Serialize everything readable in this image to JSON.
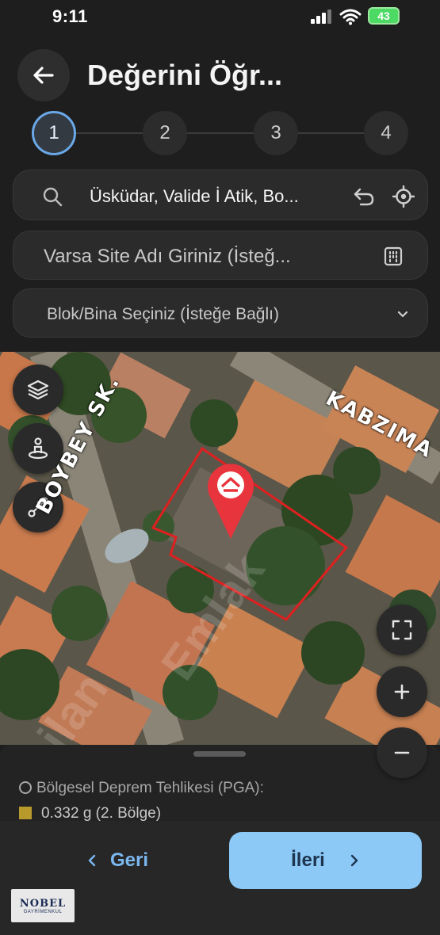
{
  "status_bar": {
    "time": "9:11",
    "battery": "43"
  },
  "header": {
    "title": "Değerini Öğr..."
  },
  "stepper": {
    "steps": [
      "1",
      "2",
      "3",
      "4"
    ],
    "active_step": 1
  },
  "search": {
    "value": "Üsküdar, Valide İ Atik, Bo..."
  },
  "site_name": {
    "placeholder": "Varsa Site Adı Giriniz (İsteğ..."
  },
  "block_select": {
    "placeholder": "Blok/Bina Seçiniz (İsteğe Bağlı)"
  },
  "map": {
    "streets": {
      "boybey": "BOYBEY SK.",
      "kabzima": "KABZIMA"
    },
    "pin_color": "#e8343c",
    "parcel_color": "#e02020"
  },
  "info_sheet": {
    "pga_label": "Bölgesel Deprem Tehlikesi (PGA):",
    "pga_value": "0.332 g (2. Bölge)",
    "pga_color": "#b89a2c"
  },
  "footer": {
    "back_label": "Geri",
    "next_label": "İleri",
    "logo_line1": "NOBEL",
    "logo_line2": "GAYRİMENKUL"
  },
  "colors": {
    "accent": "#8cc9f6",
    "active_ring": "#6aa8e8",
    "background": "#1e1e1e"
  }
}
